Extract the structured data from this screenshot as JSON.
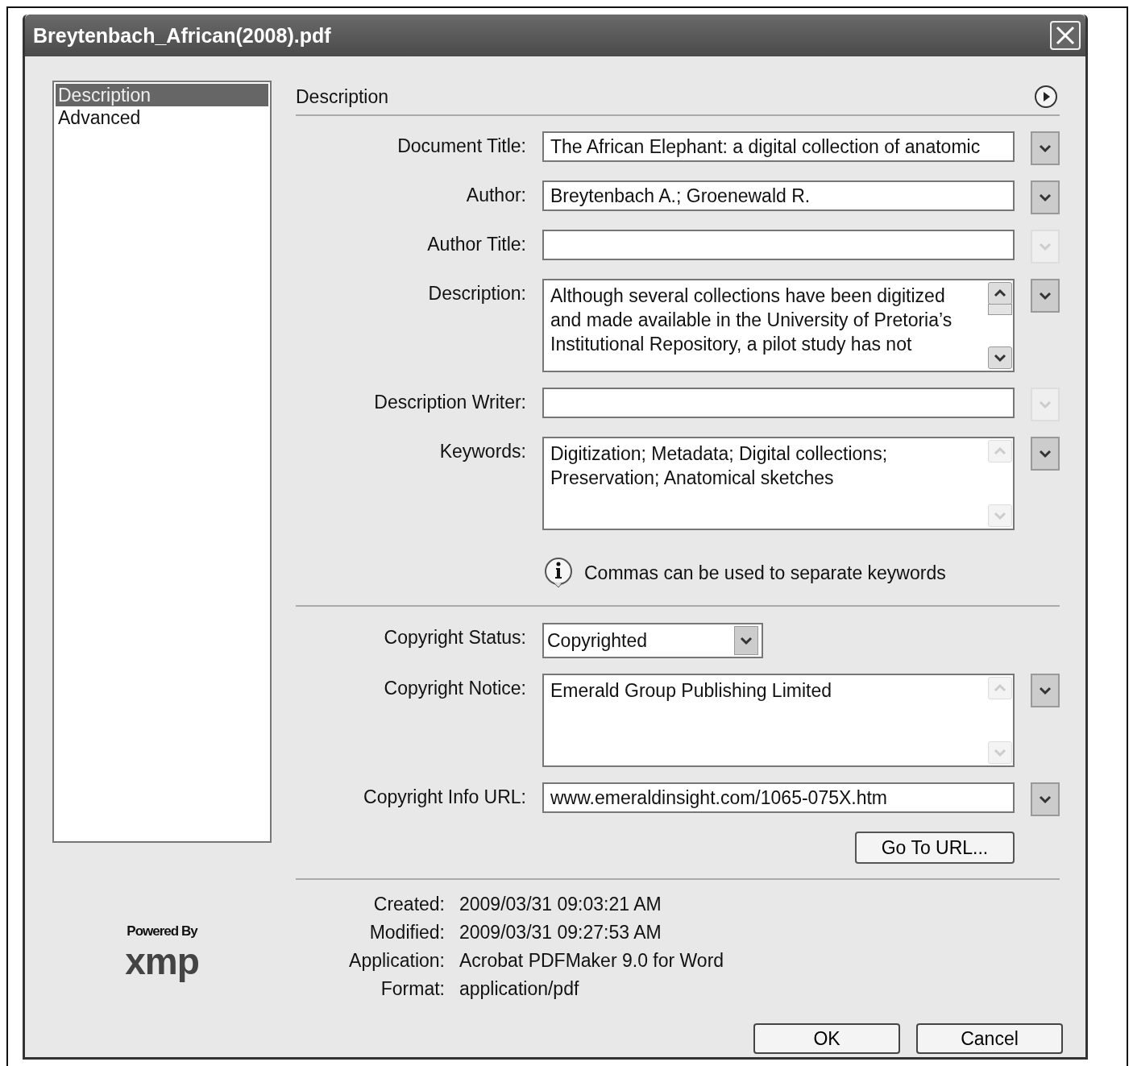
{
  "window": {
    "title": "Breytenbach_African(2008).pdf"
  },
  "sidebar": {
    "items": [
      {
        "label": "Description",
        "selected": true
      },
      {
        "label": "Advanced",
        "selected": false
      }
    ]
  },
  "panel": {
    "heading": "Description"
  },
  "fields": [
    {
      "kind": "text",
      "label": "Document Title:",
      "value": "The African Elephant: a digital collection of anatomic",
      "menu_disabled": false
    },
    {
      "kind": "text",
      "label": "Author:",
      "value": "Breytenbach A.; Groenewald R.",
      "menu_disabled": false
    },
    {
      "kind": "text",
      "label": "Author Title:",
      "menu_disabled": true
    },
    {
      "kind": "textarea",
      "label": "Description:",
      "value": "Although several collections have been digitized and made available in the University of Pretoria’s Institutional Repository, a pilot study has not",
      "scroll_disabled": false,
      "menu_disabled": false
    },
    {
      "kind": "text",
      "label": "Description Writer:",
      "menu_disabled": true
    },
    {
      "kind": "textarea",
      "label": "Keywords:",
      "value": "Digitization; Metadata; Digital collections; Preservation; Anatomical sketches",
      "scroll_disabled": true,
      "menu_disabled": false
    }
  ],
  "hint": "Commas can be used to separate keywords",
  "copyright_fields": [
    {
      "kind": "select",
      "label": "Copyright Status:",
      "value": "Copyrighted"
    },
    {
      "kind": "textarea",
      "label": "Copyright Notice:",
      "value": "Emerald Group Publishing Limited",
      "scroll_disabled": true,
      "menu_disabled": false
    },
    {
      "kind": "text",
      "label": "Copyright Info URL:",
      "value": "www.emeraldinsight.com/1065-075X.htm",
      "menu_disabled": false
    }
  ],
  "go_button": "Go To URL...",
  "info": [
    {
      "label": "Created:",
      "value": "2009/03/31 09:03:21 AM"
    },
    {
      "label": "Modified:",
      "value": "2009/03/31 09:27:53 AM"
    },
    {
      "label": "Application:",
      "value": "Acrobat PDFMaker 9.0 for Word"
    },
    {
      "label": "Format:",
      "value": "application/pdf"
    }
  ],
  "logo": {
    "caption": "Powered By",
    "name": "xmp"
  },
  "buttons": [
    "OK",
    "Cancel"
  ]
}
